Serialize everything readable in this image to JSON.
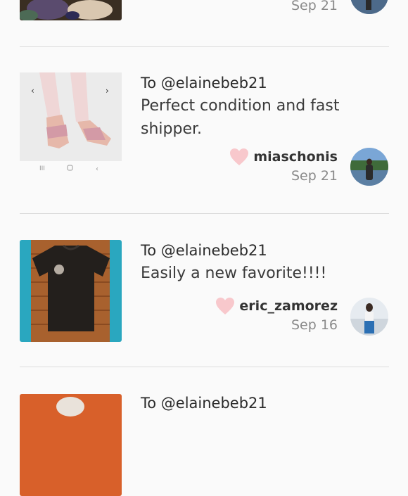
{
  "reviews": [
    {
      "to": "",
      "message": "",
      "username": "",
      "date": "Sep 21",
      "thumb": "bowls-photo",
      "avatar": "person-by-lake-avatar"
    },
    {
      "to": "To @elainebeb21",
      "message": "Perfect condition and fast shipper.",
      "username": "miaschonis",
      "date": "Sep 21",
      "thumb": "pink-foot-straps-photo",
      "avatar": "person-by-lake-avatar"
    },
    {
      "to": "To @elainebeb21",
      "message": "Easily a new favorite!!!!",
      "username": "eric_zamorez",
      "date": "Sep 16",
      "thumb": "black-tshirt-photo",
      "avatar": "person-standing-avatar"
    },
    {
      "to": "To @elainebeb21",
      "message": "",
      "username": "",
      "date": "",
      "thumb": "orange-item-photo",
      "avatar": ""
    }
  ],
  "colors": {
    "heart": "#f8c8cc",
    "divider": "#dcdcdc",
    "date": "#8a8a8a"
  }
}
